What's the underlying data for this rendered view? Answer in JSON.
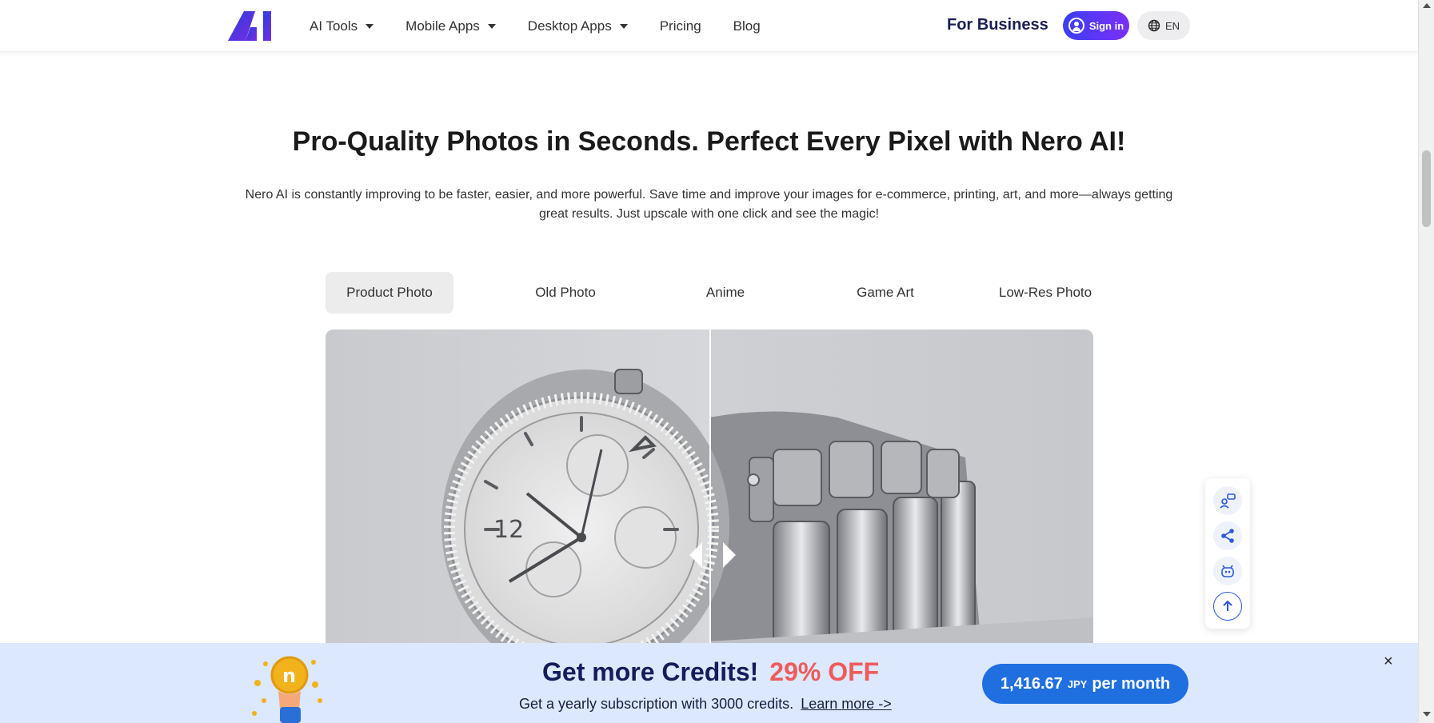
{
  "header": {
    "logo_alt": "AI",
    "nav": [
      {
        "label": "AI Tools",
        "has_dropdown": true
      },
      {
        "label": "Mobile Apps",
        "has_dropdown": true
      },
      {
        "label": "Desktop Apps",
        "has_dropdown": true
      },
      {
        "label": "Pricing",
        "has_dropdown": false
      },
      {
        "label": "Blog",
        "has_dropdown": false
      }
    ],
    "for_business": "For Business",
    "sign_in": "Sign in",
    "language": "EN"
  },
  "hero": {
    "title": "Pro-Quality Photos in Seconds. Perfect Every Pixel with Nero AI!",
    "description": "Nero AI is constantly improving to be faster, easier, and more powerful. Save time and improve your images for e-commerce, printing, art, and more—always getting great results. Just upscale with one click and see the magic!"
  },
  "tabs": [
    {
      "label": "Product Photo",
      "active": true
    },
    {
      "label": "Old Photo",
      "active": false
    },
    {
      "label": "Anime",
      "active": false
    },
    {
      "label": "Game Art",
      "active": false
    },
    {
      "label": "Low-Res Photo",
      "active": false
    }
  ],
  "comparison": {
    "subject": "wristwatch",
    "slider_position": 0.5
  },
  "sidebar": {
    "items": [
      "feedback-icon",
      "share-icon",
      "robot-icon",
      "arrow-up-icon"
    ]
  },
  "promo": {
    "title": "Get more Credits!",
    "discount": "29% OFF",
    "subtitle": "Get a yearly subscription with 3000 credits.",
    "learn_more": "Learn more ->",
    "price": "1,416.67",
    "currency": "JPY",
    "period": "per month",
    "close": "×"
  },
  "colors": {
    "accent": "#1f6fe0",
    "discount": "#ef5b5b",
    "promo_bg": "#dbe8fd"
  }
}
